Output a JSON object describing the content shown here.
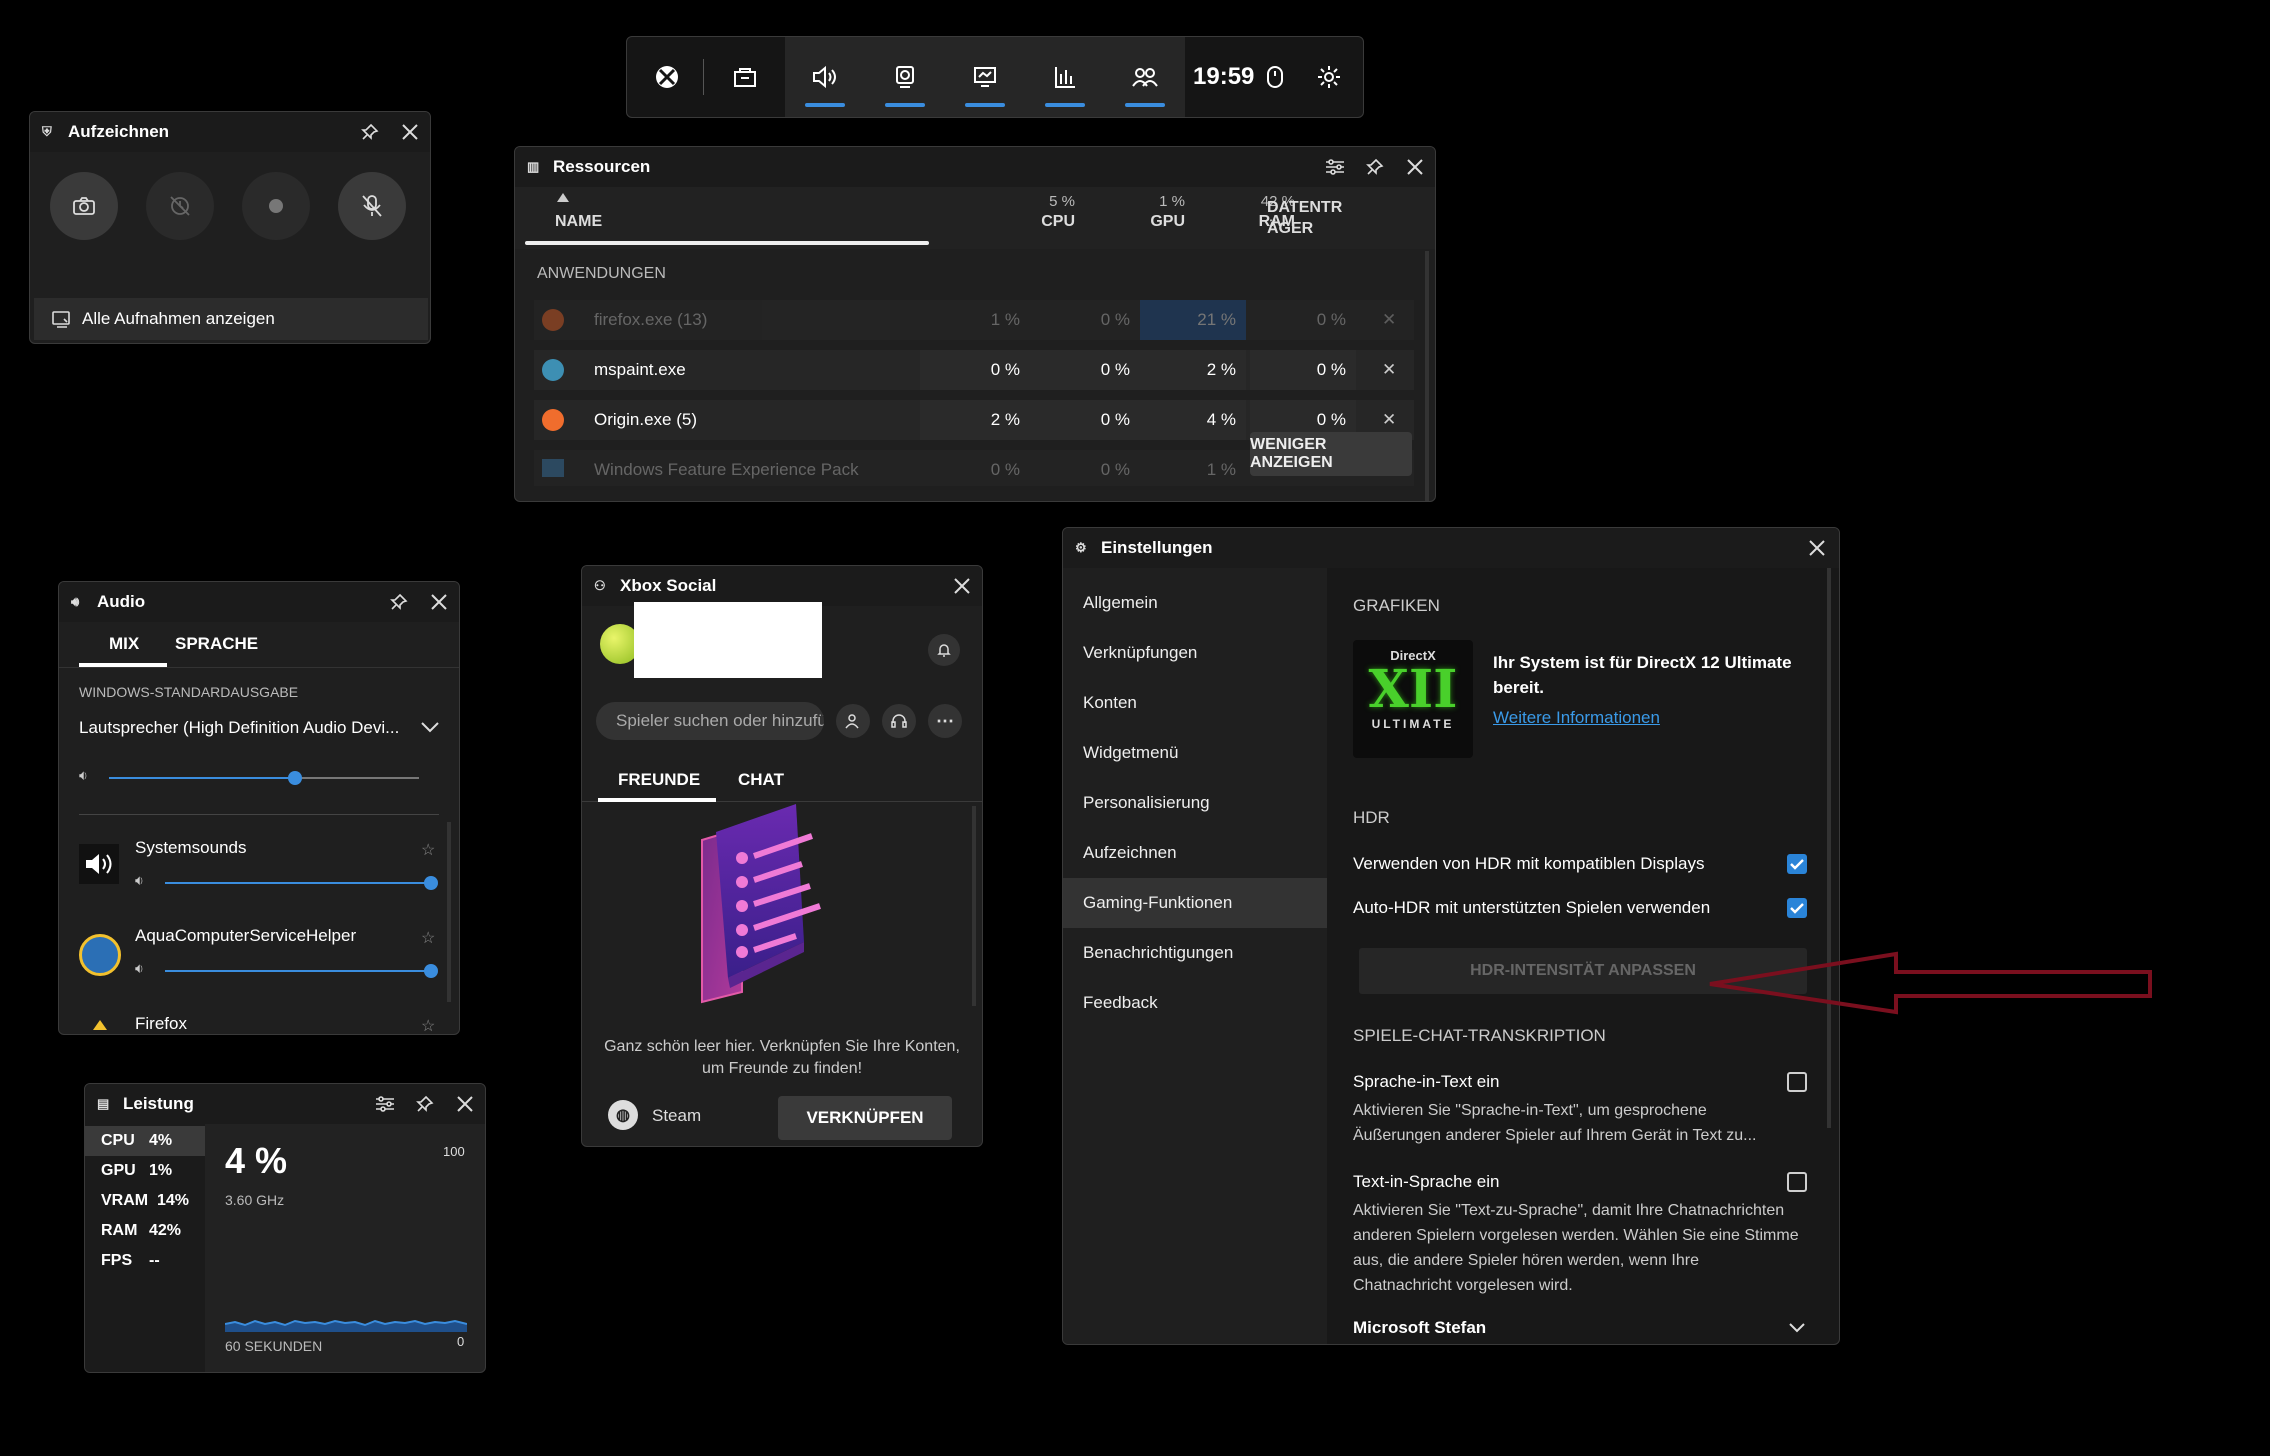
{
  "topbar": {
    "time": "19:59",
    "icons": [
      "xbox-icon",
      "widget-store-icon",
      "audio-icon",
      "capture-icon",
      "display-icon",
      "performance-icon",
      "social-icon",
      "mouse-icon",
      "gear-icon"
    ]
  },
  "aufzeichnen": {
    "title": "Aufzeichnen",
    "show_all": "Alle Aufnahmen anzeigen"
  },
  "ressourcen": {
    "title": "Ressourcen",
    "columns": {
      "name": "NAME",
      "cpu_pct": "5 %",
      "cpu": "CPU",
      "gpu_pct": "1 %",
      "gpu": "GPU",
      "ram_pct": "42 %",
      "ram": "RAM",
      "disk": "DATENTR ÄGER"
    },
    "section": "ANWENDUNGEN",
    "rows": [
      {
        "name": "firefox.exe (13)",
        "cpu": "1 %",
        "gpu": "0 %",
        "ram": "21 %",
        "disk": "0 %"
      },
      {
        "name": "mspaint.exe",
        "cpu": "0 %",
        "gpu": "0 %",
        "ram": "2 %",
        "disk": "0 %"
      },
      {
        "name": "Origin.exe (5)",
        "cpu": "2 %",
        "gpu": "0 %",
        "ram": "4 %",
        "disk": "0 %"
      },
      {
        "name": "Windows Feature Experience Pack",
        "cpu": "0 %",
        "gpu": "0 %",
        "ram": "1 %"
      }
    ],
    "show_less": "WENIGER ANZEIGEN"
  },
  "audio": {
    "title": "Audio",
    "tabs": [
      "MIX",
      "SPRACHE"
    ],
    "output_label": "WINDOWS-STANDARDAUSGABE",
    "device": "Lautsprecher (High Definition Audio Devi...",
    "master_volume": 0.6,
    "apps": [
      {
        "name": "Systemsounds",
        "volume": 1.0
      },
      {
        "name": "AquaComputerServiceHelper",
        "volume": 1.0
      },
      {
        "name": "Firefox"
      }
    ]
  },
  "social": {
    "title": "Xbox Social",
    "search_placeholder": "Spieler suchen oder hinzufügen",
    "tabs": [
      "FREUNDE",
      "CHAT"
    ],
    "empty_text": "Ganz schön leer hier. Verknüpfen Sie Ihre Konten, um Freunde zu finden!",
    "steam": "Steam",
    "link_button": "VERKNÜPFEN"
  },
  "leistung": {
    "title": "Leistung",
    "stats": [
      {
        "label": "CPU",
        "value": "4%"
      },
      {
        "label": "GPU",
        "value": "1%"
      },
      {
        "label": "VRAM",
        "value": "14%"
      },
      {
        "label": "RAM",
        "value": "42%"
      },
      {
        "label": "FPS",
        "value": "--"
      }
    ],
    "big_value": "4 %",
    "freq": "3.60 GHz",
    "max": "100",
    "min": "0",
    "timespan": "60 SEKUNDEN"
  },
  "settings": {
    "title": "Einstellungen",
    "nav": [
      "Allgemein",
      "Verknüpfungen",
      "Konten",
      "Widgetmenü",
      "Personalisierung",
      "Aufzeichnen",
      "Gaming-Funktionen",
      "Benachrichtigungen",
      "Feedback"
    ],
    "active_nav": "Gaming-Funktionen",
    "grafiken_header": "GRAFIKEN",
    "directx_logo_top": "DirectX",
    "directx_logo_mid": "XII",
    "directx_logo_bottom": "ULTIMATE",
    "directx_text": "Ihr System ist für DirectX 12 Ultimate bereit.",
    "more_info": "Weitere Informationen",
    "hdr_header": "HDR",
    "hdr_option1": "Verwenden von HDR mit kompatiblen Displays",
    "hdr_option1_checked": true,
    "hdr_option2": "Auto-HDR mit unterstützten Spielen verwenden",
    "hdr_option2_checked": true,
    "hdr_button": "HDR-INTENSITÄT ANPASSEN",
    "chat_header": "SPIELE-CHAT-TRANSKRIPTION",
    "stt_title": "Sprache-in-Text ein",
    "stt_desc": "Aktivieren Sie \"Sprache-in-Text\", um gesprochene Äußerungen anderer Spieler auf Ihrem Gerät in Text zu...",
    "tts_title": "Text-in-Sprache ein",
    "tts_desc": "Aktivieren Sie \"Text-zu-Sprache\", damit Ihre Chatnachrichten anderen Spielern vorgelesen werden. Wählen Sie eine Stimme aus, die andere Spieler hören werden, wenn Ihre Chatnachricht vorgelesen wird.",
    "voice": "Microsoft Stefan"
  },
  "colors": {
    "accent": "#3a8dde",
    "arrow": "#7a0f1e",
    "ram_highlight": "#1f4f8a"
  }
}
